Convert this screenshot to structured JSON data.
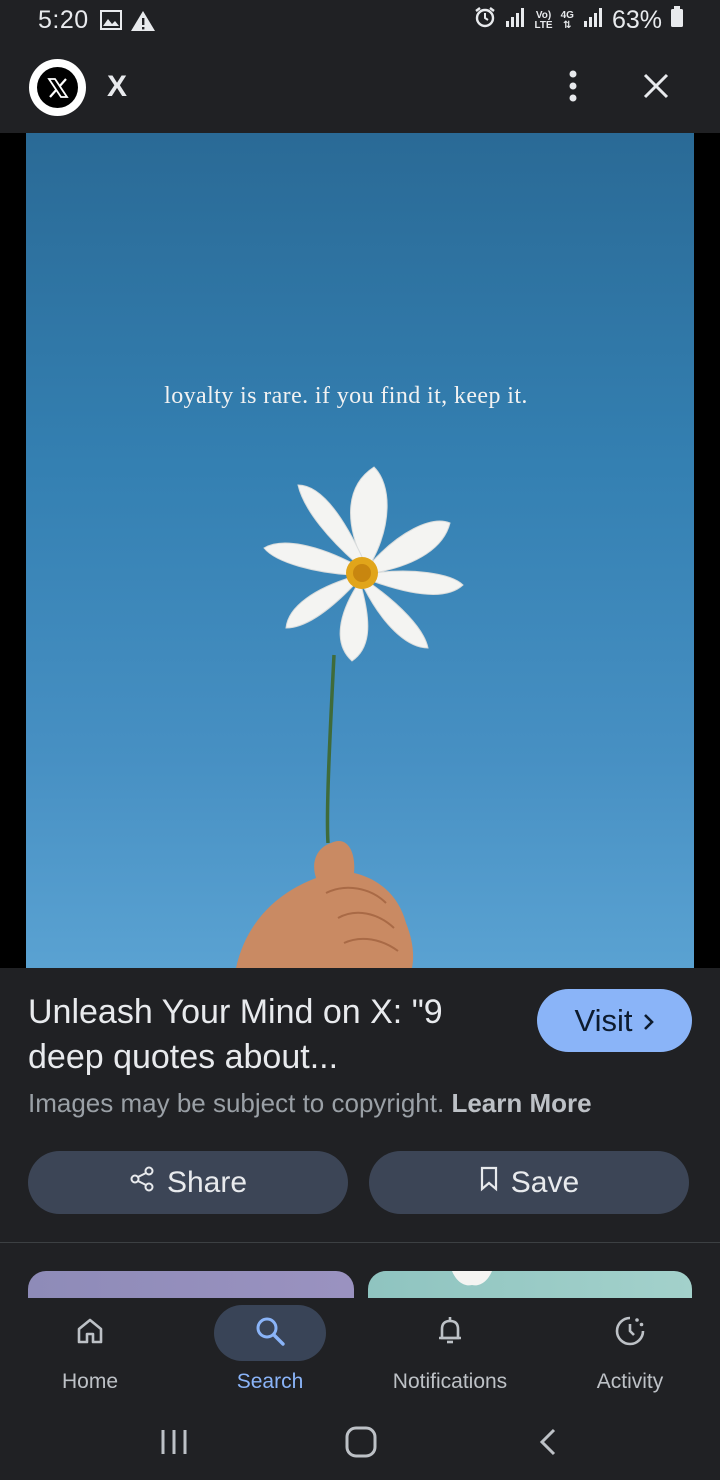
{
  "status_bar": {
    "time": "5:20",
    "network_volte": "Vo)",
    "network_lte": "LTE",
    "network_4g": "4G",
    "battery": "63%"
  },
  "app_bar": {
    "title": "X",
    "logo_icon": "x-logo-icon",
    "more_icon": "more-vert-icon",
    "close_icon": "close-icon"
  },
  "image": {
    "quote": "loyalty is rare. if you find it, keep it.",
    "lens_icon": "google-lens-icon"
  },
  "result": {
    "title": "Unleash Your Mind on X: \"9 deep quotes about...",
    "visit_label": "Visit",
    "copyright_text": "Images may be subject to copyright.",
    "learn_more": "Learn More",
    "share_label": "Share",
    "save_label": "Save"
  },
  "bottom_nav": {
    "items": [
      {
        "label": "Home",
        "icon": "home-icon",
        "active": false
      },
      {
        "label": "Search",
        "icon": "search-icon",
        "active": true
      },
      {
        "label": "Notifications",
        "icon": "bell-icon",
        "active": false
      },
      {
        "label": "Activity",
        "icon": "activity-icon",
        "active": false
      }
    ]
  },
  "colors": {
    "background": "#202124",
    "accent": "#8ab4f8",
    "button_bg": "#3c4556",
    "sky_top": "#2a6a96",
    "sky_bottom": "#5aa2d2"
  }
}
